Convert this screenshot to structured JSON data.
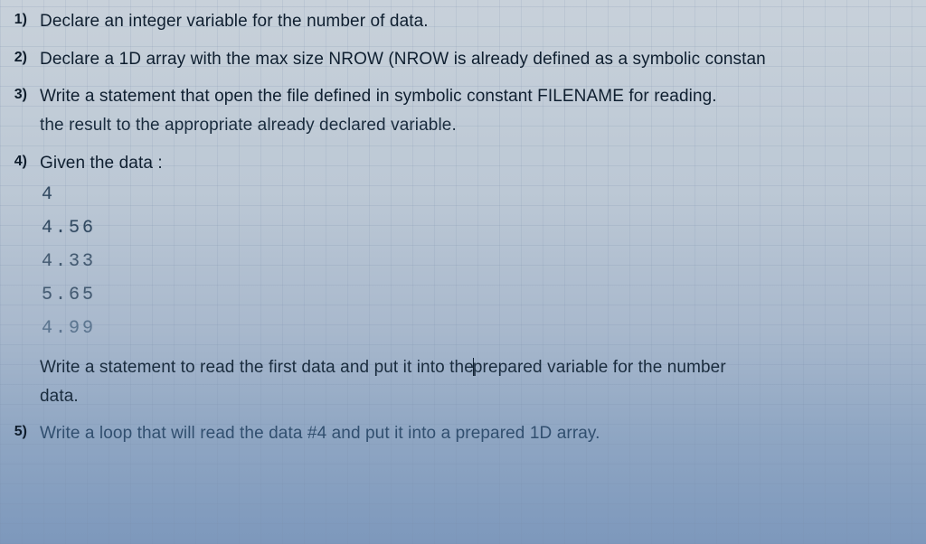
{
  "q1": {
    "num": "1)",
    "text": "Declare an integer variable for the number of data."
  },
  "q2": {
    "num": "2)",
    "text": "Declare a 1D array with the max size NROW (NROW is already defined as a symbolic constan"
  },
  "q3": {
    "num": "3)",
    "line1": "Write a statement that open the file defined in symbolic constant FILENAME for reading.",
    "line2": "the result to the appropriate already declared variable."
  },
  "q4": {
    "num": "4)",
    "lead": "Given the data :",
    "data": [
      "4",
      "4.56",
      "4.33",
      "5.65",
      "4.99"
    ],
    "tail1a": "Write a statement to read the first data and put it into the",
    "tail1b": "prepared variable for the number",
    "tail2": "data."
  },
  "q5": {
    "num": "5)",
    "text": "Write a loop that will read the data #4 and put it into a prepared 1D array."
  }
}
